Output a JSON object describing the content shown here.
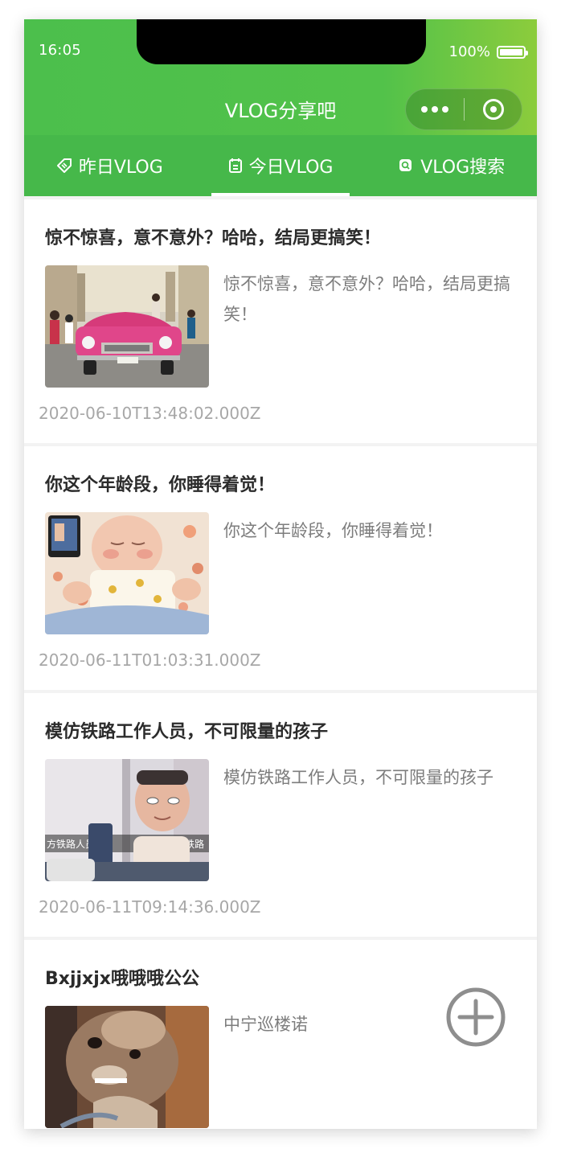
{
  "status": {
    "time": "16:05",
    "battery": "100%"
  },
  "app": {
    "title": "VLOG分享吧"
  },
  "tabs": [
    {
      "label": "昨日VLOG",
      "icon": "tag-icon"
    },
    {
      "label": "今日VLOG",
      "icon": "calendar-icon",
      "active": true
    },
    {
      "label": "VLOG搜索",
      "icon": "search-icon"
    }
  ],
  "posts": [
    {
      "title": "惊不惊喜，意不意外？哈哈，结局更搞笑！",
      "desc": "惊不惊喜，意不意外？哈哈，结局更搞笑！",
      "time": "2020-06-10T13:48:02.000Z",
      "thumb": "pink-car-street"
    },
    {
      "title": "你这个年龄段，你睡得着觉！",
      "desc": "你这个年龄段，你睡得着觉！",
      "time": "2020-06-11T01:03:31.000Z",
      "thumb": "sleeping-baby"
    },
    {
      "title": "模仿铁路工作人员，不可限量的孩子",
      "desc": "模仿铁路工作人员，不可限量的孩子",
      "time": "2020-06-11T09:14:36.000Z",
      "thumb": "kid-railway",
      "caption_left": "方铁路人员",
      "caption_right": "模仿铁路"
    },
    {
      "title": "Bxjjxjx哦哦哦公公",
      "desc": "中宁巡楼诺",
      "time": "",
      "thumb": "small-dog"
    }
  ],
  "colors": {
    "accent": "#46b84a",
    "header_end": "#8ccc3c"
  }
}
